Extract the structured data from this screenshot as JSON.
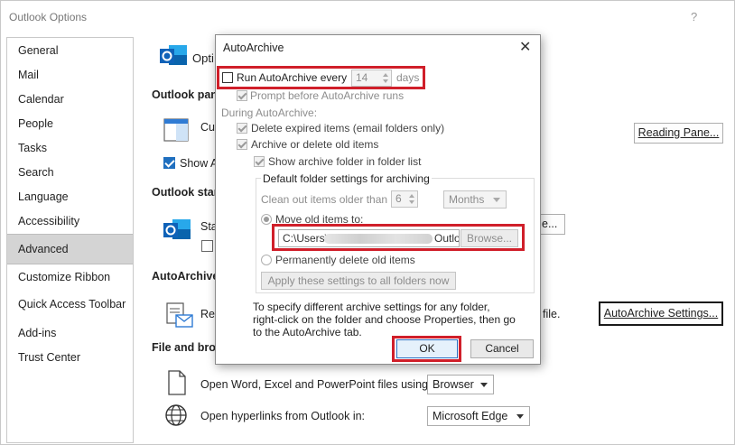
{
  "window": {
    "title": "Outlook Options",
    "help": "?"
  },
  "sidebar": {
    "items": [
      {
        "label": "General"
      },
      {
        "label": "Mail"
      },
      {
        "label": "Calendar"
      },
      {
        "label": "People"
      },
      {
        "label": "Tasks"
      },
      {
        "label": "Search"
      },
      {
        "label": "Language"
      },
      {
        "label": "Accessibility"
      },
      {
        "label": "Advanced",
        "selected": true
      },
      {
        "label": "Customize Ribbon"
      },
      {
        "label": "Quick Access Toolbar"
      },
      {
        "label": "Add-ins"
      },
      {
        "label": "Trust Center"
      }
    ]
  },
  "main": {
    "header_partial": "Opti",
    "outlook_panes_title": "Outlook pane",
    "customize_partial": "Cu",
    "show_partial": "Show A",
    "reading_pane_button": "Reading Pane...",
    "outlook_start_title": "Outlook start",
    "start_partial": "Sta",
    "start_button_partial": "e...",
    "autoarchive_title": "AutoArchive",
    "autoarchive_partial": "Re",
    "autoarchive_tail": "file.",
    "autoarchive_settings_button": "AutoArchive Settings...",
    "file_browser_title": "File and brow",
    "open_files_label": "Open Word, Excel and PowerPoint files using:",
    "open_files_value": "Browser",
    "open_links_label": "Open hyperlinks from Outlook in:",
    "open_links_value": "Microsoft Edge"
  },
  "dialog": {
    "title": "AutoArchive",
    "close": "✕",
    "run_label": "Run AutoArchive every",
    "run_checked": false,
    "run_days_value": "14",
    "run_days_unit": "days",
    "prompt_label": "Prompt before AutoArchive runs",
    "during_label": "During AutoArchive:",
    "delete_expired_label": "Delete expired items (email folders only)",
    "archive_old_label": "Archive or delete old items",
    "show_folder_label": "Show archive folder in folder list",
    "group_title": "Default folder settings for archiving",
    "clean_out_label": "Clean out items older than",
    "clean_out_value": "6",
    "clean_out_unit": "Months",
    "move_label": "Move old items to:",
    "path_start": "C:\\Users\\",
    "path_end": "Outlo",
    "browse_button": "Browse...",
    "perm_delete_label": "Permanently delete old items",
    "apply_button": "Apply these settings to all folders now",
    "info_text_1": "To specify different archive settings for any folder,",
    "info_text_2": "right-click on the folder and choose Properties, then go",
    "info_text_3": "to the AutoArchive tab.",
    "ok_button": "OK",
    "cancel_button": "Cancel"
  },
  "colors": {
    "highlight_red": "#d01f2a",
    "outlook_blue": "#0f62b8",
    "selected_nav": "#d4d4d4"
  }
}
